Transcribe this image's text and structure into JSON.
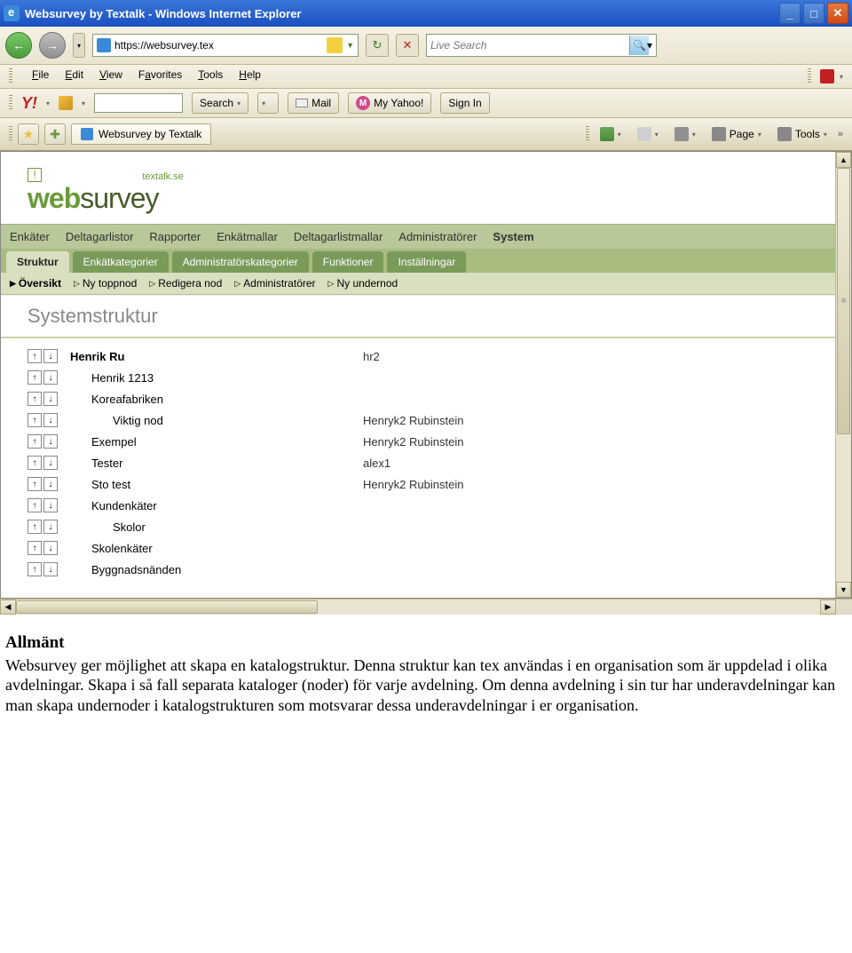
{
  "window": {
    "title": "Websurvey by Textalk - Windows Internet Explorer"
  },
  "address": {
    "url": "https://websurvey.tex"
  },
  "search": {
    "placeholder": "Live Search"
  },
  "menu": {
    "file": "File",
    "edit": "Edit",
    "view": "View",
    "favorites": "Favorites",
    "tools": "Tools",
    "help": "Help"
  },
  "yahoo": {
    "logo": "Y!",
    "search": "Search",
    "mail": "Mail",
    "my": "My Yahoo!",
    "signin": "Sign In"
  },
  "tab": {
    "title": "Websurvey by Textalk"
  },
  "cmdbar": {
    "page": "Page",
    "tools": "Tools"
  },
  "logo": {
    "top": "textalk.se",
    "left": "web",
    "right": "survey"
  },
  "mainTabs": [
    "Enkäter",
    "Deltagarlistor",
    "Rapporter",
    "Enkätmallar",
    "Deltagarlistmallar",
    "Administratörer",
    "System"
  ],
  "subTabs": [
    "Struktur",
    "Enkätkategorier",
    "Administratörskategorier",
    "Funktioner",
    "Inställningar"
  ],
  "subNav": [
    "Översikt",
    "Ny toppnod",
    "Redigera nod",
    "Administratörer",
    "Ny undernod"
  ],
  "sectionTitle": "Systemstruktur",
  "tree": [
    {
      "label": "Henrik Ru",
      "indent": 0,
      "bold": true,
      "col2": "hr2"
    },
    {
      "label": "Henrik 1213",
      "indent": 1,
      "bold": false,
      "col2": ""
    },
    {
      "label": "Koreafabriken",
      "indent": 1,
      "bold": false,
      "col2": ""
    },
    {
      "label": "Viktig nod",
      "indent": 2,
      "bold": false,
      "col2": "Henryk2 Rubinstein"
    },
    {
      "label": "Exempel",
      "indent": 1,
      "bold": false,
      "col2": "Henryk2 Rubinstein"
    },
    {
      "label": "Tester",
      "indent": 1,
      "bold": false,
      "col2": "alex1"
    },
    {
      "label": "Sto test",
      "indent": 1,
      "bold": false,
      "col2": "Henryk2 Rubinstein"
    },
    {
      "label": "Kundenkäter",
      "indent": 1,
      "bold": false,
      "col2": ""
    },
    {
      "label": "Skolor",
      "indent": 2,
      "bold": false,
      "col2": ""
    },
    {
      "label": "Skolenkäter",
      "indent": 1,
      "bold": false,
      "col2": ""
    },
    {
      "label": "Byggnadsnänden",
      "indent": 1,
      "bold": false,
      "col2": ""
    }
  ],
  "doc": {
    "heading": "Allmänt",
    "body": "Websurvey ger möjlighet att skapa en katalogstruktur. Denna struktur kan tex användas i en organisation som är uppdelad i olika avdelningar. Skapa i så fall separata kataloger (noder) för varje avdelning. Om denna avdelning i sin tur har underavdelningar kan man skapa undernoder i katalogstrukturen som motsvarar dessa underavdelningar i er organisation."
  }
}
